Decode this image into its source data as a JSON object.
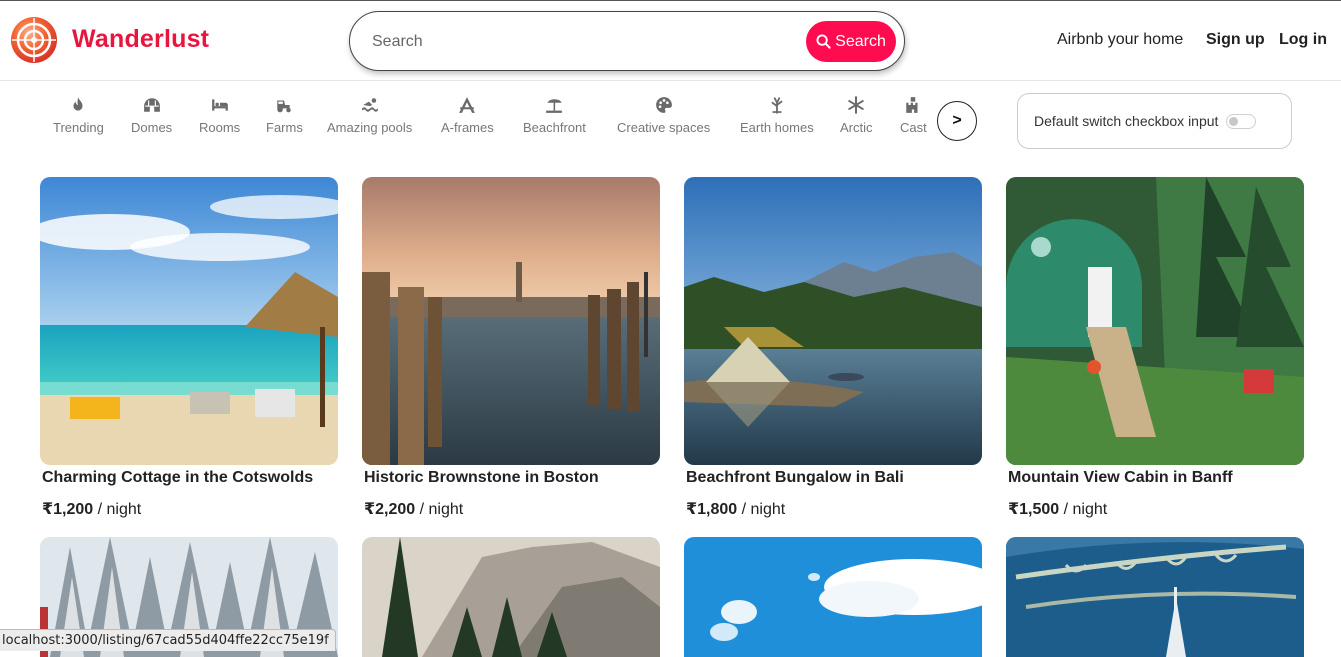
{
  "navbar": {
    "brand": "Wanderlust",
    "search_placeholder": "Search",
    "search_button": "Search",
    "host_link": "Airbnb your home",
    "signup": "Sign up",
    "login": "Log in",
    "brand_color": "#e8153e",
    "accent_color": "#fe0c4f"
  },
  "filters": {
    "items": [
      {
        "label": "Trending",
        "icon": "fire-icon"
      },
      {
        "label": "Domes",
        "icon": "igloo-icon"
      },
      {
        "label": "Rooms",
        "icon": "bed-icon"
      },
      {
        "label": "Farms",
        "icon": "tractor-icon"
      },
      {
        "label": "Amazing pools",
        "icon": "person-swimming-icon"
      },
      {
        "label": "A-frames",
        "icon": "a-frame-icon"
      },
      {
        "label": "Beachfront",
        "icon": "umbrella-beach-icon"
      },
      {
        "label": "Creative spaces",
        "icon": "palette-icon"
      },
      {
        "label": "Earth homes",
        "icon": "leaf-icon"
      },
      {
        "label": "Arctic",
        "icon": "snowflake-icon"
      },
      {
        "label": "Cast",
        "icon": "castle-icon"
      }
    ],
    "next_button": ">",
    "toggle_label": "Default switch checkbox input",
    "toggle_on": false
  },
  "listings": [
    {
      "title": "Charming Cottage in the Cotswolds",
      "price": "₹1,200",
      "per": " / night"
    },
    {
      "title": "Historic Brownstone in Boston",
      "price": "₹2,200",
      "per": " / night"
    },
    {
      "title": "Beachfront Bungalow in Bali",
      "price": "₹1,800",
      "per": " / night"
    },
    {
      "title": "Mountain View Cabin in Banff",
      "price": "₹1,500",
      "per": " / night"
    }
  ],
  "status_bar": "localhost:3000/listing/67cad55d404ffe22cc75e19f"
}
